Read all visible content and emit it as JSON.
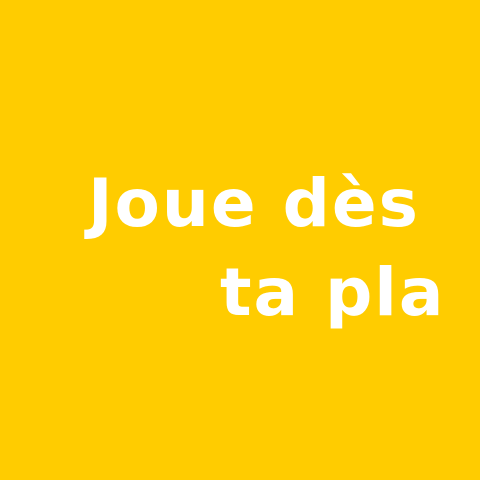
{
  "colors": {
    "background": "#FFCC00",
    "text": "#FFFFFF"
  },
  "headline": {
    "line1": "Joue dès",
    "line2": "ta pla"
  }
}
